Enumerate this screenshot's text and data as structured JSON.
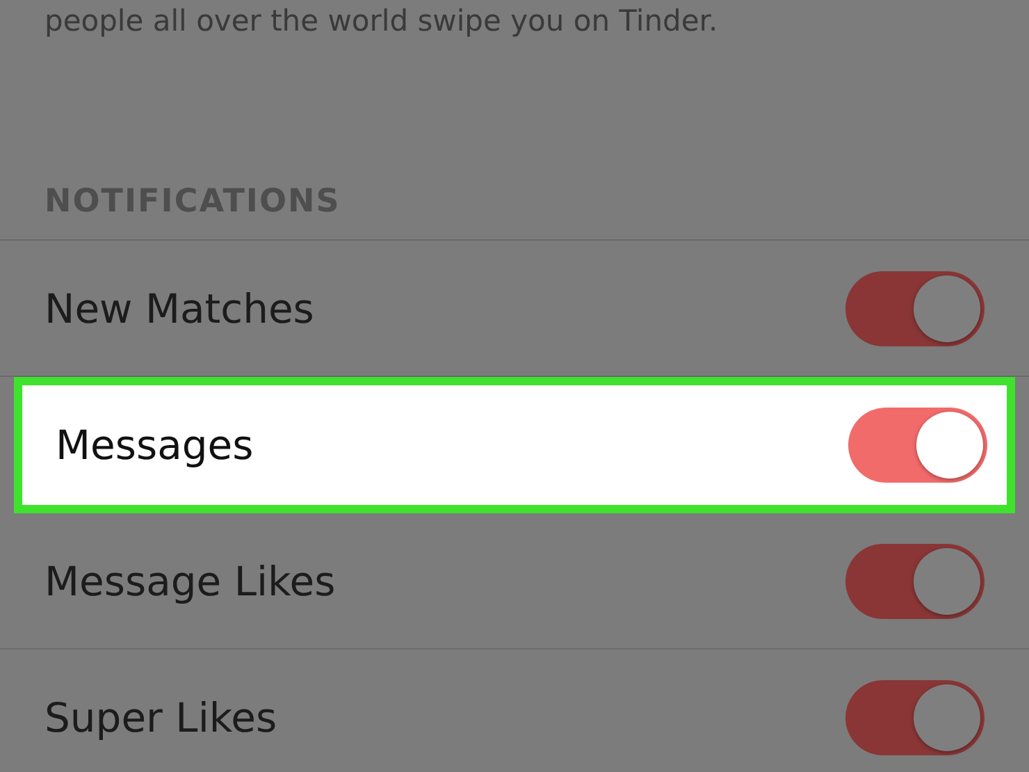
{
  "description": "people all over the world swipe you on Tinder.",
  "section": {
    "title": "NOTIFICATIONS"
  },
  "rows": [
    {
      "label": "New Matches",
      "on": true,
      "highlighted": false
    },
    {
      "label": "Messages",
      "on": true,
      "highlighted": true
    },
    {
      "label": "Message Likes",
      "on": true,
      "highlighted": false
    },
    {
      "label": "Super Likes",
      "on": true,
      "highlighted": false
    }
  ]
}
